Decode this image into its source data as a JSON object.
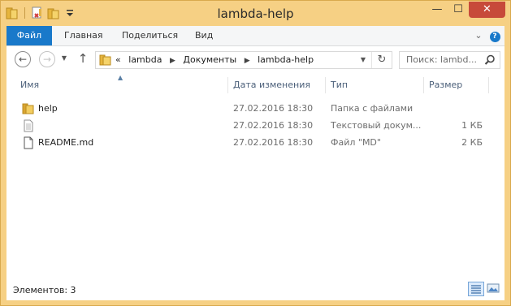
{
  "window": {
    "title": "lambda-help",
    "controls": {
      "minimize": "—",
      "maximize": "☐",
      "close": "✕"
    }
  },
  "ribbon": {
    "tabs": [
      {
        "label": "Файл",
        "active": true
      },
      {
        "label": "Главная"
      },
      {
        "label": "Поделиться"
      },
      {
        "label": "Вид"
      }
    ],
    "expand_glyph": "⌄",
    "help_glyph": "?"
  },
  "nav": {
    "back_glyph": "←",
    "forward_glyph": "→",
    "recent_glyph": "▼",
    "up_glyph": "↑",
    "breadcrumbs": [
      "lambda",
      "Документы",
      "lambda-help"
    ],
    "overflow_glyph": "«",
    "separator_glyph": "▶",
    "dropdown_glyph": "▼",
    "refresh_glyph": "↻",
    "search_placeholder": "Поиск: lambd..."
  },
  "columns": {
    "name": "Имя",
    "date": "Дата изменения",
    "type": "Тип",
    "size": "Размер"
  },
  "files": [
    {
      "icon": "folder-icon",
      "name": "help",
      "date": "27.02.2016 18:30",
      "type": "Папка с файлами",
      "size": ""
    },
    {
      "icon": "text-file-icon",
      "name": "",
      "date": "27.02.2016 18:30",
      "type": "Текстовый докум...",
      "size": "1 КБ"
    },
    {
      "icon": "text-file-icon",
      "name": "README.md",
      "date": "27.02.2016 18:30",
      "type": "Файл \"MD\"",
      "size": "2 КБ"
    }
  ],
  "status": {
    "items_text": "Элементов: 3"
  },
  "colors": {
    "frame": "#f6d084",
    "file_tab": "#1979ca",
    "header_text": "#4c607a",
    "close_button": "#c74a3a"
  }
}
